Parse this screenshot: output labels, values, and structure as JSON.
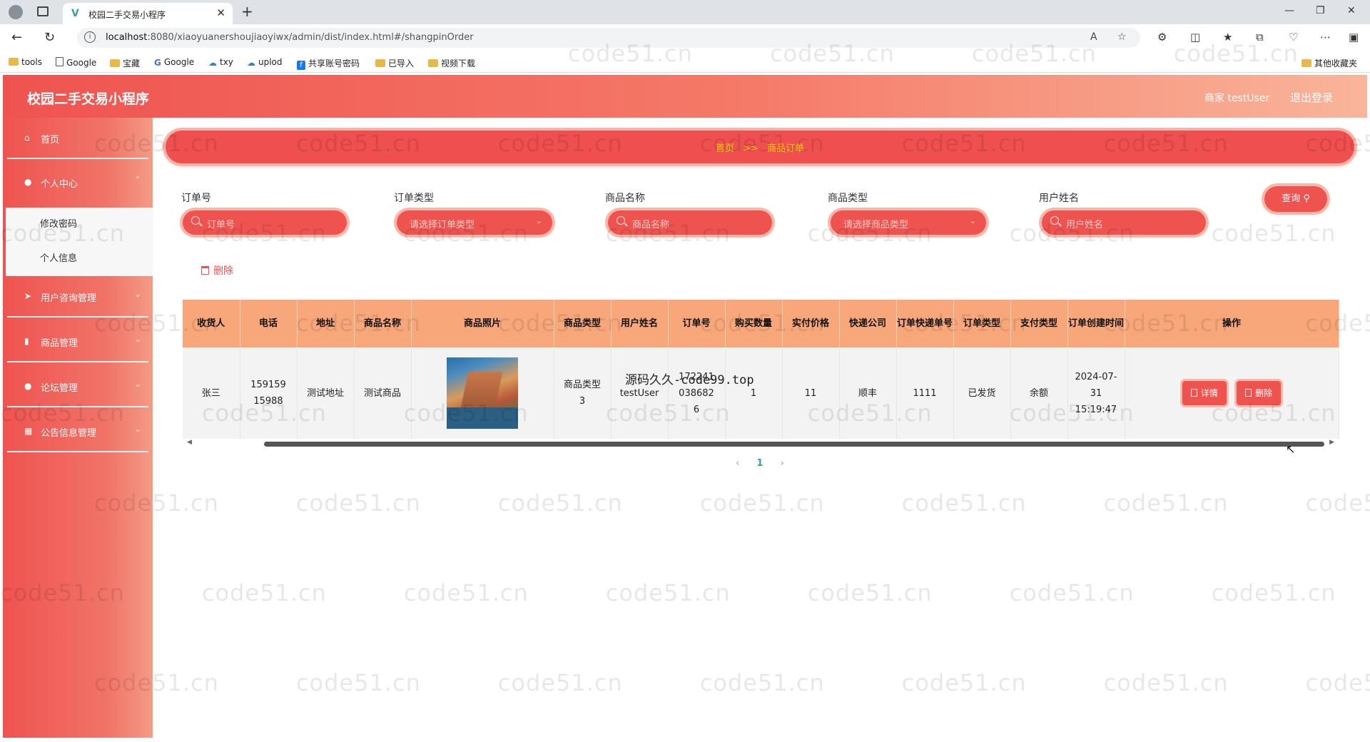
{
  "browser": {
    "tab_title": "校园二手交易小程序",
    "tab_favicon": "V",
    "url_host": "localhost",
    "url_rest": ":8080/xiaoyuanershoujiaoyiwx/admin/dist/index.html#/shangpinOrder",
    "bookmarks": [
      "tools",
      "Google",
      "宝藏",
      "Google",
      "txy",
      "uplod",
      "共享账号密码",
      "已导入",
      "视频下载"
    ],
    "bookmark_other": "其他收藏夹"
  },
  "app": {
    "title": "校园二手交易小程序",
    "user_label": "商家 testUser",
    "logout": "退出登录"
  },
  "sidebar": {
    "items": [
      {
        "label": "首页",
        "icon": "home-icon"
      },
      {
        "label": "个人中心",
        "icon": "user-icon"
      },
      {
        "label": "用户咨询管理",
        "icon": "send-icon"
      },
      {
        "label": "商品管理",
        "icon": "chart-icon"
      },
      {
        "label": "论坛管理",
        "icon": "user-icon"
      },
      {
        "label": "公告信息管理",
        "icon": "grid-icon"
      }
    ],
    "submenu": [
      "修改密码",
      "个人信息"
    ]
  },
  "breadcrumb": {
    "home": "首页",
    "sep": ">>",
    "current": "商品订单"
  },
  "filters": [
    {
      "label": "订单号",
      "placeholder": "订单号",
      "type": "input"
    },
    {
      "label": "订单类型",
      "placeholder": "请选择订单类型",
      "type": "select"
    },
    {
      "label": "商品名称",
      "placeholder": "商品名称",
      "type": "input"
    },
    {
      "label": "商品类型",
      "placeholder": "请选择商品类型",
      "type": "select"
    },
    {
      "label": "用户姓名",
      "placeholder": "用户姓名",
      "type": "input"
    }
  ],
  "query_button": "查询",
  "delete_button": "删除",
  "table": {
    "headers": [
      "收货人",
      "电话",
      "地址",
      "商品名称",
      "商品照片",
      "商品类型",
      "用户姓名",
      "订单号",
      "购买数量",
      "实付价格",
      "快递公司",
      "订单快递单号",
      "订单类型",
      "支付类型",
      "订单创建时间",
      "操作"
    ],
    "rows": [
      {
        "receiver": "张三",
        "phone": "15915915988",
        "address": "测试地址",
        "product_name": "测试商品",
        "product_type": "商品类型3",
        "user_name": "testUser",
        "order_no": "1722410386826",
        "quantity": "1",
        "price": "11",
        "courier": "顺丰",
        "tracking_no": "1111",
        "order_type": "已发货",
        "pay_type": "余额",
        "created": "2024-07-31 15:19:47",
        "action_detail": "详情",
        "action_delete": "删除"
      }
    ]
  },
  "pager": {
    "prev": "‹",
    "current": "1",
    "next": "›"
  },
  "overlay_text": "源码久久-code99.top",
  "watermark": "code51.cn",
  "colors": {
    "primary": "#ef5350",
    "header_light": "#f9b59b",
    "table_header": "#f8a77a",
    "breadcrumb_text": "#ffd600"
  }
}
